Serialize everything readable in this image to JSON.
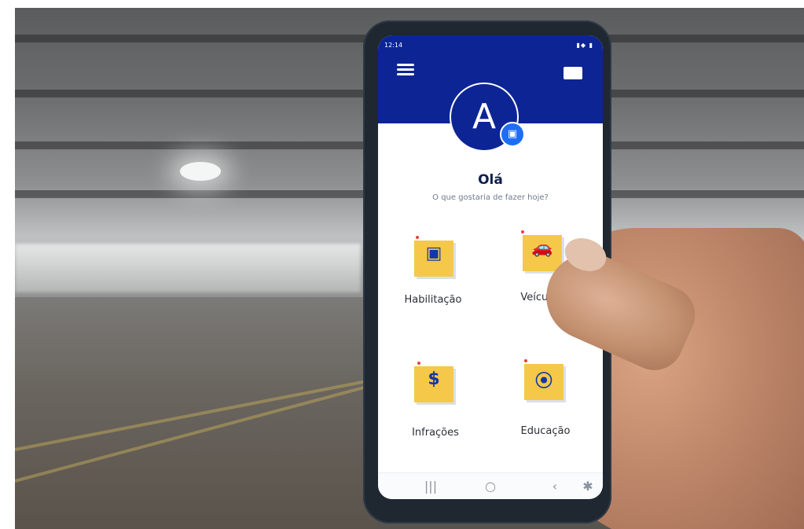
{
  "status_bar": {
    "time": "12:14",
    "icons": "▮◆ ▮"
  },
  "header": {
    "menu_icon": "hamburger-icon",
    "mail_icon": "mail-icon"
  },
  "profile": {
    "avatar_letter": "A",
    "camera_icon": "camera-icon"
  },
  "greeting": {
    "title": "Olá",
    "subtitle": "O que gostaria de fazer hoje?"
  },
  "menu_items": [
    {
      "label": "Habilitação",
      "icon": "id-card-icon",
      "glyph": "▣"
    },
    {
      "label": "Veículos",
      "icon": "car-icon",
      "glyph": "🚗"
    },
    {
      "label": "Infrações",
      "icon": "fine-document-icon",
      "glyph": "$"
    },
    {
      "label": "Educação",
      "icon": "traffic-light-icon",
      "glyph": "⦿"
    }
  ],
  "system_nav": {
    "recent": "|||",
    "home": "○",
    "back": "‹",
    "accessibility": "✱"
  },
  "colors": {
    "brand_blue": "#0d2594",
    "tile_yellow": "#f5c84a",
    "camera_blue": "#1d6ef5"
  }
}
